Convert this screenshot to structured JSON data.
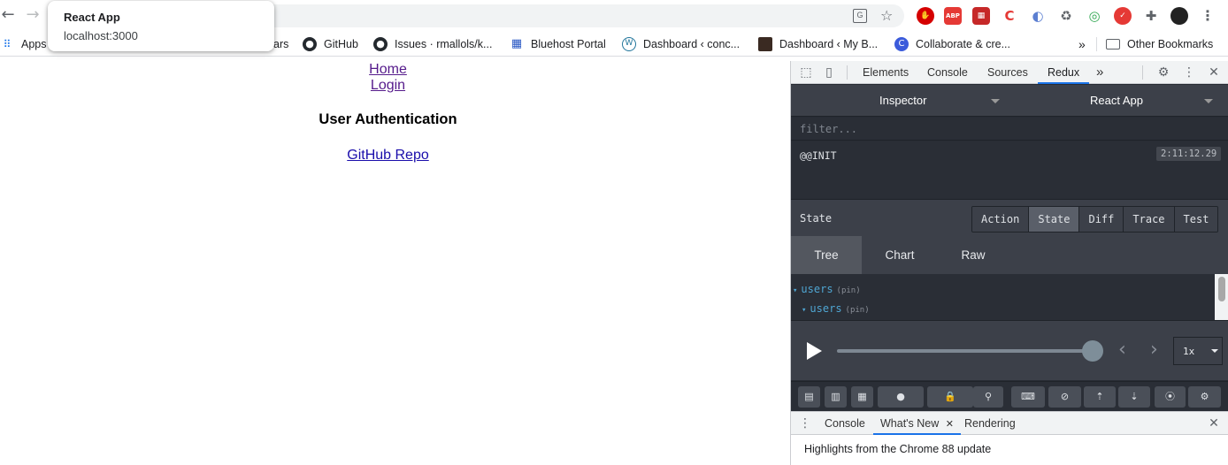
{
  "browser": {
    "tooltip": {
      "title": "React App",
      "url": "localhost:3000"
    },
    "nav": {
      "back_icon": "arrow-left-icon",
      "forward_icon": "arrow-right-icon"
    },
    "bookmarks": [
      {
        "label": "Apps",
        "icon": "apps-grid-icon"
      },
      {
        "label": "ars"
      },
      {
        "label": "GitHub",
        "icon": "github-icon"
      },
      {
        "label": "Issues · rmallols/k...",
        "icon": "github-icon"
      },
      {
        "label": "Bluehost Portal",
        "icon": "bluehost-icon"
      },
      {
        "label": "Dashboard ‹ conc...",
        "icon": "wordpress-icon"
      },
      {
        "label": "Dashboard ‹ My B...",
        "icon": "avatar-icon"
      },
      {
        "label": "Collaborate & cre...",
        "icon": "collaborate-icon"
      }
    ],
    "bookmarks_overflow": "»",
    "other_bookmarks": "Other Bookmarks",
    "extensions": {
      "abp": "ABP"
    }
  },
  "page": {
    "links": {
      "home": "Home",
      "login": "Login",
      "repo": "GitHub Repo"
    },
    "heading": "User Authentication"
  },
  "devtools": {
    "tabs": {
      "elements": "Elements",
      "console": "Console",
      "sources": "Sources",
      "redux": "Redux",
      "more": "»"
    },
    "redux": {
      "inspector": "Inspector",
      "instance": "React App",
      "filter_placeholder": "filter...",
      "action_name": "@@INIT",
      "action_time": "2:11:12.29",
      "state_label": "State",
      "modes": [
        "Action",
        "State",
        "Diff",
        "Trace",
        "Test"
      ],
      "active_mode": "State",
      "subtabs": [
        "Tree",
        "Chart",
        "Raw"
      ],
      "active_subtab": "Tree",
      "tree": [
        {
          "key": "users",
          "pin": "(pin)"
        },
        {
          "key": "users",
          "pin": "(pin)"
        }
      ],
      "speed": "1x"
    },
    "drawer": {
      "tabs": {
        "console": "Console",
        "whats_new": "What's New",
        "rendering": "Rendering"
      },
      "close": "×",
      "body": "Highlights from the Chrome 88 update"
    }
  }
}
